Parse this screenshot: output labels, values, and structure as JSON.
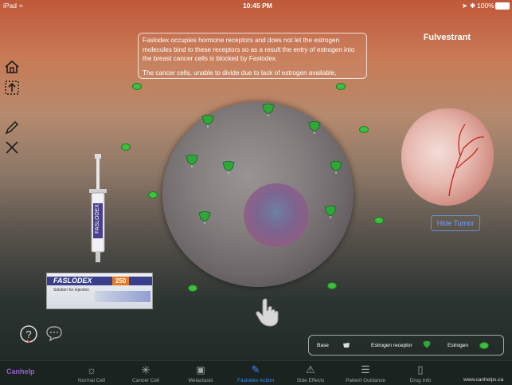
{
  "status_bar": {
    "carrier": "iPad",
    "time": "10:45 PM",
    "battery": "100%"
  },
  "title": "Fulvestrant",
  "info_text": {
    "p1": "Faslodex occupies hormone receptors and does not let the estrogen molecules bind to these receptors so as a result the entry of estrogen into the breast cancer cells is blocked by Faslodex.",
    "p2": "The cancer cells, unable to divide due to lack of estrogen available,"
  },
  "product": {
    "box_brand": "FASLODEX",
    "box_dose": "250",
    "box_sub": "Solution for injection",
    "syringe_label": "FASLODEX"
  },
  "buttons": {
    "hide_tumor": "Hide Tumor"
  },
  "legend": {
    "base": "Base",
    "receptor": "Estrogen receptor",
    "estrogen": "Estrogen"
  },
  "tabs": [
    {
      "label": "Canhelp",
      "icon": "ribbon-icon"
    },
    {
      "label": "Normal Cell",
      "icon": "sun-icon"
    },
    {
      "label": "Cancer Cell",
      "icon": "starburst-icon"
    },
    {
      "label": "Metastasis",
      "icon": "film-icon"
    },
    {
      "label": "Faslodex Action",
      "icon": "syringe-icon"
    },
    {
      "label": "Side Effects",
      "icon": "warning-icon"
    },
    {
      "label": "Patient Guidance",
      "icon": "clipboard-icon"
    },
    {
      "label": "Drug Info",
      "icon": "book-icon"
    }
  ],
  "website": "www.canhelps.ca",
  "colors": {
    "active_tab": "#3b8bff",
    "receptor": "#2fa83a",
    "estrogen": "#3fbf3f",
    "button_text": "#6fa0ff"
  }
}
